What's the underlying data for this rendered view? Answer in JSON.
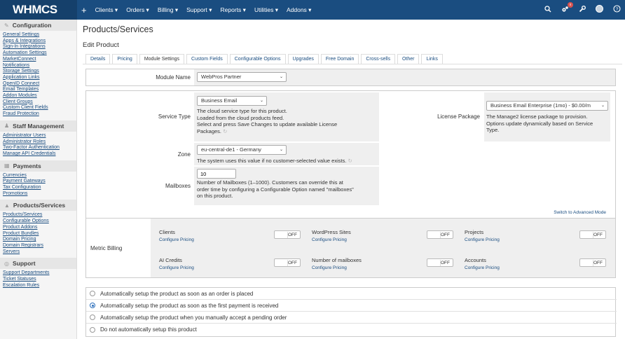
{
  "topbar": {
    "logo": "WHMCS",
    "nav": [
      {
        "label": "Clients ▾"
      },
      {
        "label": "Orders ▾"
      },
      {
        "label": "Billing ▾"
      },
      {
        "label": "Support ▾"
      },
      {
        "label": "Reports ▾"
      },
      {
        "label": "Utilities ▾"
      },
      {
        "label": "Addons ▾"
      }
    ],
    "badge": "x"
  },
  "sidebar": {
    "sections": [
      {
        "title": "Configuration",
        "links": [
          "General Settings",
          "Apps & Integrations",
          "Sign-In Integrations",
          "Automation Settings",
          "MarketConnect",
          "Notifications",
          "Storage Settings",
          "Application Links",
          "OpenID Connect",
          "Email Templates",
          "Addon Modules",
          "Client Groups",
          "Custom Client Fields",
          "Fraud Protection"
        ]
      },
      {
        "title": "Staff Management",
        "links": [
          "Administrator Users",
          "Administrator Roles",
          "Two-Factor Authentication",
          "Manage API Credentials"
        ]
      },
      {
        "title": "Payments",
        "links": [
          "Currencies",
          "Payment Gateways",
          "Tax Configuration",
          "Promotions"
        ]
      },
      {
        "title": "Products/Services",
        "links": [
          "Products/Services",
          "Configurable Options",
          "Product Addons",
          "Product Bundles",
          "Domain Pricing",
          "Domain Registrars",
          "Servers"
        ]
      },
      {
        "title": "Support",
        "links": [
          "Support Departments",
          "Ticket Statuses",
          "Escalation Rules"
        ]
      }
    ]
  },
  "page": {
    "title": "Products/Services",
    "subtitle": "Edit Product"
  },
  "tabs": [
    "Details",
    "Pricing",
    "Module Settings",
    "Custom Fields",
    "Configurable Options",
    "Upgrades",
    "Free Domain",
    "Cross-sells",
    "Other",
    "Links"
  ],
  "module": {
    "label": "Module Name",
    "value": "WebPros Partner"
  },
  "service_type": {
    "label": "Service Type",
    "value": "Business Email",
    "help": [
      "The cloud service type for this product.",
      "Loaded from the cloud products feed.",
      "Select and press Save Changes to update available License",
      "Packages."
    ]
  },
  "license_package": {
    "label": "License Package",
    "value": "Business Email Enterprise (1mo) - $0.00/m",
    "help": [
      "The Manage2 license package to provision.",
      "Options update dynamically based on Service",
      "Type."
    ]
  },
  "zone": {
    "label": "Zone",
    "value": "eu-central-de1 - Germany",
    "help": "The system uses this value if no customer-selected value exists."
  },
  "mailboxes": {
    "label": "Mailboxes",
    "value": "10",
    "help": [
      "Number of Mailboxes (1–1000). Customers can override this at",
      "order time by configuring a Configurable Option named \"mailboxes\"",
      "on this product."
    ]
  },
  "advanced_link": "Switch to Advanced Mode",
  "metric_billing": {
    "label": "Metric Billing",
    "configure_label": "Configure Pricing",
    "toggle_label": "OFF",
    "metrics": [
      "Clients",
      "WordPress Sites",
      "Projects",
      "AI Credits",
      "Number of mailboxes",
      "Accounts"
    ]
  },
  "setup_options": [
    {
      "label": "Automatically setup the product as soon as an order is placed",
      "selected": false
    },
    {
      "label": "Automatically setup the product as soon as the first payment is received",
      "selected": true
    },
    {
      "label": "Automatically setup the product when you manually accept a pending order",
      "selected": false
    },
    {
      "label": "Do not automatically setup this product",
      "selected": false
    }
  ],
  "icons": {
    "search": "search-icon",
    "notifications": "cogs-icon",
    "wrench": "wrench-icon",
    "avatar": "avatar",
    "help": "help-icon"
  }
}
